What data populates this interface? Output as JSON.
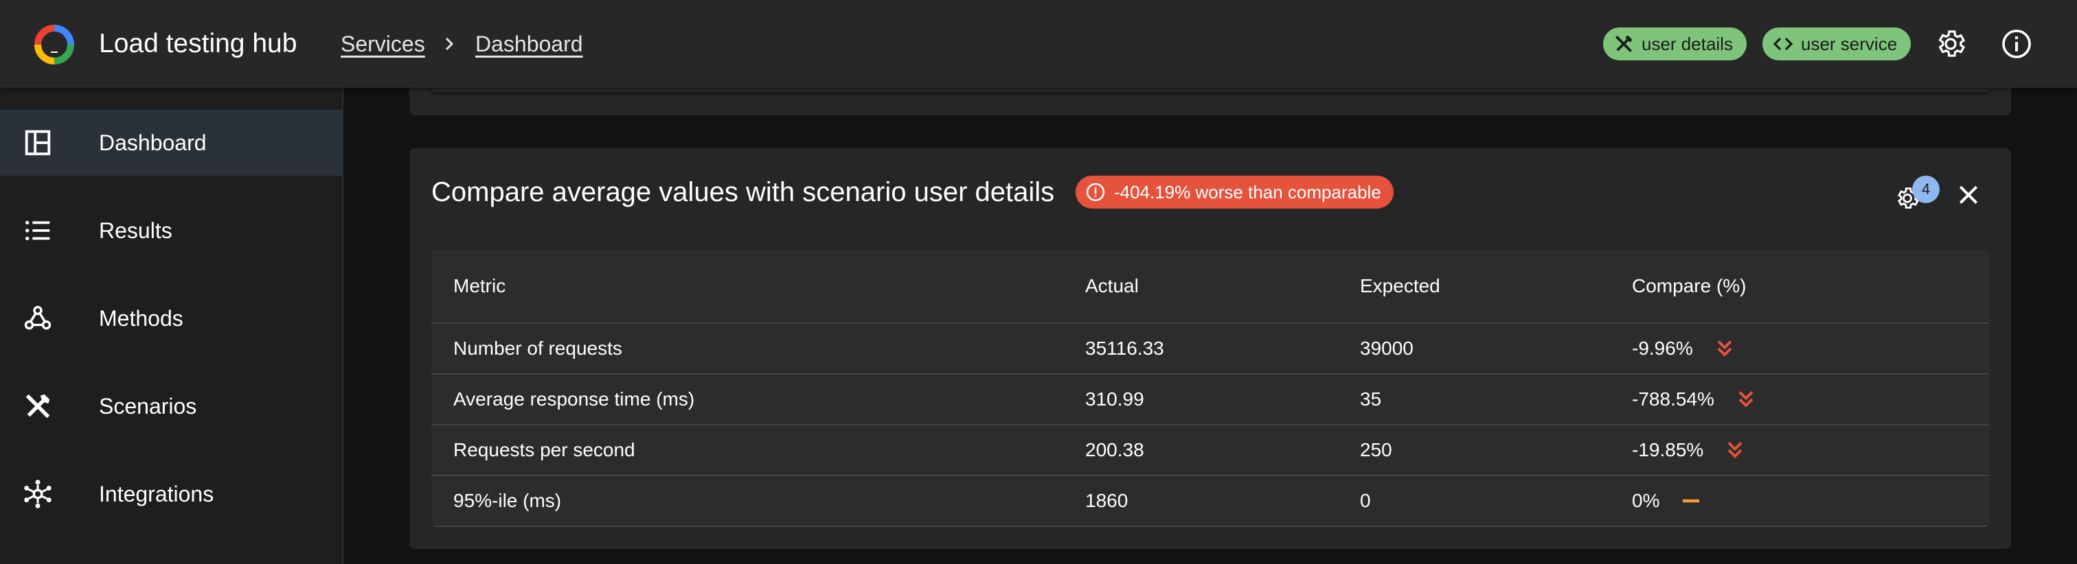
{
  "app": {
    "title": "Load testing hub"
  },
  "breadcrumb": [
    {
      "label": "Services"
    },
    {
      "label": "Dashboard"
    }
  ],
  "header": {
    "chips": [
      {
        "label": "user details",
        "icon": "tools-icon"
      },
      {
        "label": "user service",
        "icon": "code-icon"
      }
    ],
    "icons": [
      "settings-icon",
      "info-icon"
    ]
  },
  "sidebar": {
    "items": [
      {
        "label": "Dashboard",
        "icon": "dashboard-icon",
        "active": true
      },
      {
        "label": "Results",
        "icon": "list-icon",
        "active": false
      },
      {
        "label": "Methods",
        "icon": "webhook-icon",
        "active": false
      },
      {
        "label": "Scenarios",
        "icon": "tools-icon",
        "active": false
      },
      {
        "label": "Integrations",
        "icon": "hub-icon",
        "active": false
      }
    ]
  },
  "card": {
    "title": "Compare average values with scenario user details",
    "alert": "-404.19% worse than comparable",
    "settings_count": "4"
  },
  "table": {
    "columns": [
      "Metric",
      "Actual",
      "Expected",
      "Compare (%)"
    ],
    "rows": [
      {
        "metric": "Number of requests",
        "actual": "35116.33",
        "expected": "39000",
        "compare": "-9.96%",
        "trend": "down"
      },
      {
        "metric": "Average response time (ms)",
        "actual": "310.99",
        "expected": "35",
        "compare": "-788.54%",
        "trend": "down"
      },
      {
        "metric": "Requests per second",
        "actual": "200.38",
        "expected": "250",
        "compare": "-19.85%",
        "trend": "down"
      },
      {
        "metric": "95%-ile (ms)",
        "actual": "1860",
        "expected": "0",
        "compare": "0%",
        "trend": "neutral"
      }
    ]
  },
  "colors": {
    "chip": "#7ec47b",
    "alert": "#e5533d",
    "badge": "#8fb8f0",
    "trend_down": "#e5533d",
    "trend_neutral": "#f0a030",
    "active_nav": "#2a3139"
  }
}
